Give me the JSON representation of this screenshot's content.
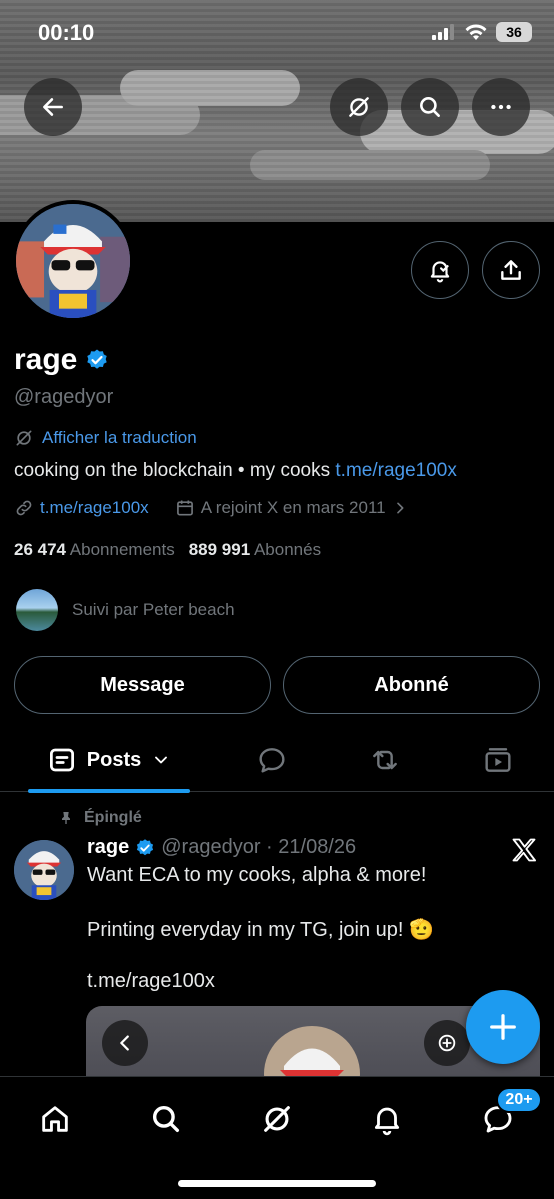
{
  "status_bar": {
    "time": "00:10",
    "battery": "36"
  },
  "profile": {
    "name": "rage",
    "handle": "@ragedyor",
    "translate_label": "Afficher la traduction",
    "bio_text": "cooking on the blockchain • my cooks ",
    "bio_link": "t.me/rage100x",
    "website": "t.me/rage100x",
    "joined": "A rejoint X en mars 2011",
    "following_count": "26 474",
    "following_label": "Abonnements",
    "followers_count": "889 991",
    "followers_label": "Abonnés",
    "followed_by": "Suivi par Peter beach"
  },
  "actions": {
    "message": "Message",
    "following": "Abonné"
  },
  "tabs": {
    "posts": "Posts"
  },
  "post": {
    "pinned_label": "Épinglé",
    "author": "rage",
    "handle_date": "@ragedyor · 21/08/26",
    "line1": "Want ECA to my cooks, alpha & more!",
    "line2": "Printing everyday in my TG, join up! 🫡",
    "link": "t.me/rage100x"
  },
  "nav": {
    "messages_badge": "20+"
  },
  "colors": {
    "accent": "#1d9bf0",
    "link": "#4a99e9",
    "muted": "#71767b",
    "verified": "#1d9bf0"
  }
}
